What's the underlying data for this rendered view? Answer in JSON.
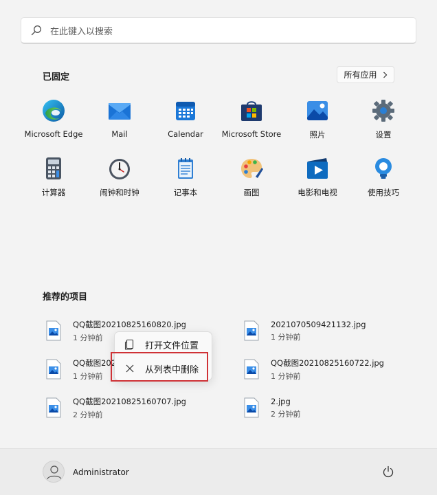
{
  "search": {
    "placeholder": "在此键入以搜索",
    "icon": "search-icon"
  },
  "pinned": {
    "title": "已固定",
    "all_apps_label": "所有应用",
    "apps": [
      {
        "label": "Microsoft Edge",
        "icon": "edge-icon"
      },
      {
        "label": "Mail",
        "icon": "mail-icon"
      },
      {
        "label": "Calendar",
        "icon": "calendar-icon"
      },
      {
        "label": "Microsoft Store",
        "icon": "store-icon"
      },
      {
        "label": "照片",
        "icon": "photos-icon"
      },
      {
        "label": "设置",
        "icon": "settings-icon"
      },
      {
        "label": "计算器",
        "icon": "calculator-icon"
      },
      {
        "label": "闹钟和时钟",
        "icon": "clock-icon"
      },
      {
        "label": "记事本",
        "icon": "notepad-icon"
      },
      {
        "label": "画图",
        "icon": "paint-icon"
      },
      {
        "label": "电影和电视",
        "icon": "movies-icon"
      },
      {
        "label": "使用技巧",
        "icon": "tips-icon"
      }
    ]
  },
  "recommended": {
    "title": "推荐的项目",
    "items": [
      {
        "name": "QQ截图20210825160820.jpg",
        "time": "1 分钟前"
      },
      {
        "name": "2021070509421132.jpg",
        "time": "1 分钟前"
      },
      {
        "name": "QQ截图202",
        "time": "1 分钟前"
      },
      {
        "name": "QQ截图20210825160722.jpg",
        "time": "1 分钟前"
      },
      {
        "name": "QQ截图20210825160707.jpg",
        "time": "2 分钟前"
      },
      {
        "name": "2.jpg",
        "time": "2 分钟前"
      }
    ]
  },
  "context_menu": {
    "items": [
      {
        "label": "打开文件位置",
        "icon": "open-folder-icon"
      },
      {
        "label": "从列表中删除",
        "icon": "close-icon"
      }
    ]
  },
  "footer": {
    "username": "Administrator",
    "power_icon": "power-icon"
  },
  "colors": {
    "highlight": "#cf3236",
    "accent": "#0078d4"
  }
}
